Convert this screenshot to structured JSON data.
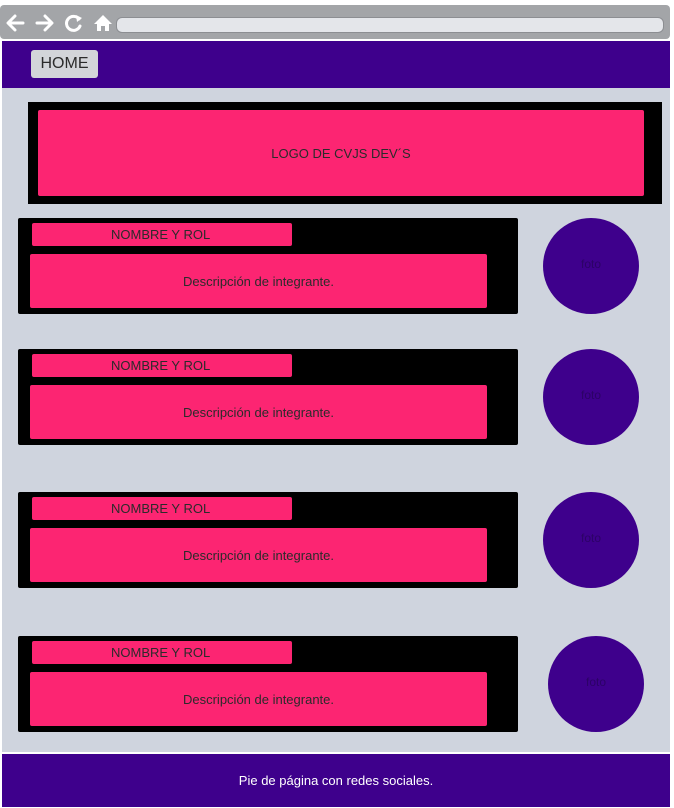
{
  "browser": {
    "icons": [
      "back-arrow-icon",
      "forward-arrow-icon",
      "reload-icon",
      "home-icon"
    ]
  },
  "header": {
    "home_label": "HOME"
  },
  "logo": {
    "text": "LOGO DE CVJS DEV´S"
  },
  "members": [
    {
      "name_role": "NOMBRE Y ROL",
      "description": "Descripción de integrante.",
      "photo_label": "foto"
    },
    {
      "name_role": "NOMBRE Y ROL",
      "description": "Descripción de integrante.",
      "photo_label": "foto"
    },
    {
      "name_role": "NOMBRE Y ROL",
      "description": "Descripción de integrante.",
      "photo_label": "foto"
    },
    {
      "name_role": "NOMBRE Y ROL",
      "description": "Descripción de integrante.",
      "photo_label": "foto"
    }
  ],
  "footer": {
    "text": "Pie de página con redes sociales."
  },
  "colors": {
    "accent_purple": "#3e008c",
    "accent_pink": "#fc2572",
    "background": "#cfd4de"
  }
}
